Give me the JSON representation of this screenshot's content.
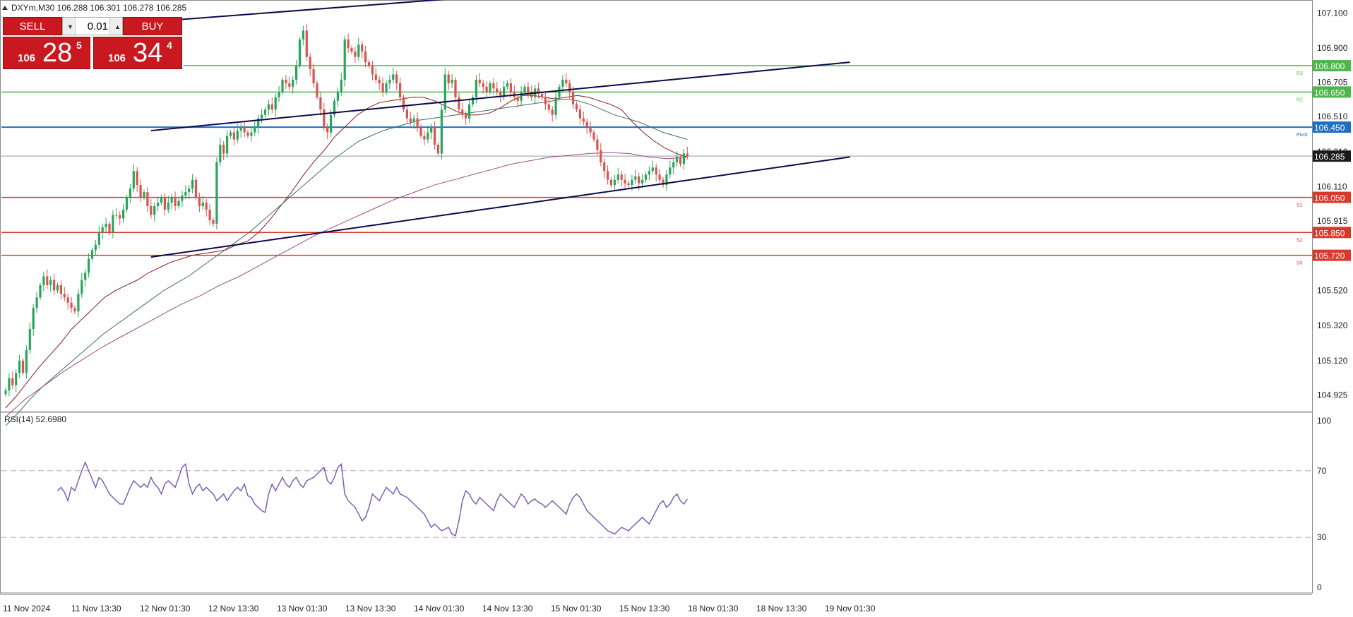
{
  "header": {
    "symbol_label": "DXYm,M30",
    "ohlc": "106.288 106.301 106.278 106.285"
  },
  "trade_panel": {
    "sell_label": "SELL",
    "buy_label": "BUY",
    "lot_value": "0.01",
    "sell_price": {
      "small": "106",
      "big": "28",
      "sup": "5"
    },
    "buy_price": {
      "small": "106",
      "big": "34",
      "sup": "4"
    }
  },
  "colors": {
    "bull_candle": "#26a65b",
    "bear_candle": "#d9534f",
    "pivot": "#1e6fc2",
    "resistance": "#4cb84c",
    "support": "#d83a2a",
    "trendline": "#0a0a4a",
    "ma_fast": "#8b1a1a",
    "ma_mid": "#3c6e60",
    "ma_slow": "#9b4a8c",
    "rsi": "#7b5fb8"
  },
  "chart_data": [
    {
      "type": "candlestick",
      "name": "DXYm,M30",
      "ylim": [
        104.85,
        107.15
      ],
      "price_axis_labels": [
        "107.100",
        "106.900",
        "106.705",
        "106.510",
        "106.310",
        "106.110",
        "105.915",
        "105.720",
        "105.520",
        "105.320",
        "105.120",
        "104.925"
      ],
      "x_tick_labels": [
        "11 Nov 2024",
        "11 Nov 13:30",
        "12 Nov 01:30",
        "12 Nov 13:30",
        "13 Nov 01:30",
        "13 Nov 13:30",
        "14 Nov 01:30",
        "14 Nov 13:30",
        "15 Nov 01:30",
        "15 Nov 13:30",
        "18 Nov 01:30",
        "18 Nov 13:30",
        "19 Nov 01:30"
      ],
      "current_price": {
        "value": 106.285,
        "label": "106.285"
      },
      "levels": [
        {
          "name": "R3",
          "value": 106.8,
          "label": "106.800",
          "kind": "resistance"
        },
        {
          "name": "R2",
          "value": 106.65,
          "label": "106.650",
          "kind": "resistance"
        },
        {
          "name": "Pivot",
          "value": 106.45,
          "label": "106.450",
          "kind": "pivot"
        },
        {
          "name": "S1",
          "value": 106.05,
          "label": "106.050",
          "kind": "support"
        },
        {
          "name": "S2",
          "value": 105.85,
          "label": "105.850",
          "kind": "support"
        },
        {
          "name": "S3",
          "value": 105.72,
          "label": "105.720",
          "kind": "support"
        }
      ],
      "trendlines": [
        {
          "from": {
            "bar": 42,
            "price": 107.05
          },
          "to": {
            "bar": 148,
            "price": 107.21
          }
        },
        {
          "from": {
            "bar": 42,
            "price": 106.43
          },
          "to": {
            "bar": 244,
            "price": 106.82
          }
        },
        {
          "from": {
            "bar": 42,
            "price": 105.71
          },
          "to": {
            "bar": 244,
            "price": 106.28
          }
        }
      ],
      "close": [
        104.95,
        105.02,
        104.98,
        105.05,
        105.12,
        105.05,
        105.18,
        105.3,
        105.42,
        105.48,
        105.55,
        105.6,
        105.55,
        105.58,
        105.52,
        105.55,
        105.5,
        105.48,
        105.45,
        105.42,
        105.4,
        105.5,
        105.58,
        105.62,
        105.7,
        105.75,
        105.78,
        105.85,
        105.88,
        105.9,
        105.85,
        105.95,
        105.95,
        105.93,
        105.98,
        106.05,
        106.1,
        106.2,
        106.12,
        106.05,
        106.08,
        106.0,
        105.95,
        106.0,
        106.02,
        106.05,
        105.98,
        106.02,
        106.05,
        106.0,
        106.03,
        106.06,
        106.08,
        106.1,
        106.15,
        106.05,
        106.0,
        106.02,
        105.98,
        105.92,
        105.9,
        106.25,
        106.35,
        106.3,
        106.4,
        106.42,
        106.38,
        106.43,
        106.45,
        106.42,
        106.4,
        106.42,
        106.45,
        106.5,
        106.52,
        106.55,
        106.58,
        106.55,
        106.62,
        106.65,
        106.72,
        106.7,
        106.68,
        106.72,
        106.8,
        106.95,
        107.0,
        106.85,
        106.78,
        106.7,
        106.62,
        106.55,
        106.45,
        106.42,
        106.52,
        106.6,
        106.65,
        106.72,
        106.95,
        106.9,
        106.88,
        106.85,
        106.92,
        106.88,
        106.82,
        106.8,
        106.75,
        106.72,
        106.7,
        106.65,
        106.7,
        106.72,
        106.75,
        106.7,
        106.62,
        106.55,
        106.5,
        106.48,
        106.5,
        106.45,
        106.4,
        106.38,
        106.42,
        106.45,
        106.35,
        106.3,
        106.55,
        106.75,
        106.7,
        106.72,
        106.62,
        106.55,
        106.52,
        106.5,
        106.58,
        106.62,
        106.72,
        106.7,
        106.68,
        106.65,
        106.7,
        106.67,
        106.65,
        106.63,
        106.68,
        106.7,
        106.65,
        106.62,
        106.6,
        106.65,
        106.68,
        106.65,
        106.62,
        106.67,
        106.64,
        106.62,
        106.58,
        106.55,
        106.52,
        106.62,
        106.68,
        106.72,
        106.7,
        106.65,
        106.58,
        106.55,
        106.5,
        106.48,
        106.45,
        106.42,
        106.38,
        106.32,
        106.25,
        106.2,
        106.15,
        106.12,
        106.15,
        106.18,
        106.15,
        106.13,
        106.12,
        106.15,
        106.17,
        106.13,
        106.15,
        106.18,
        106.2,
        106.22,
        106.18,
        106.15,
        106.12,
        106.18,
        106.22,
        106.25,
        106.28,
        106.24,
        106.3,
        106.285
      ],
      "moving_averages": [
        {
          "values": [
            104.85,
            104.92,
            105.0,
            105.08,
            105.15,
            105.22,
            105.3,
            105.36,
            105.42,
            105.48,
            105.52,
            105.55,
            105.58,
            105.62,
            105.65,
            105.68,
            105.7,
            105.72,
            105.73,
            105.74,
            105.75,
            105.78,
            105.8,
            105.85,
            105.92,
            106.0,
            106.08,
            106.17,
            106.25,
            106.32,
            106.4,
            106.46,
            106.52,
            106.56,
            106.59,
            106.6,
            106.61,
            106.62,
            106.62,
            106.6,
            106.57,
            106.54,
            106.52,
            106.52,
            106.53,
            106.56,
            106.6,
            106.63,
            106.63,
            106.62,
            106.61,
            106.62,
            106.63,
            106.62,
            106.6,
            106.58,
            106.55,
            106.48,
            106.42,
            106.37,
            106.33,
            106.3,
            106.28
          ]
        },
        {
          "values": [
            104.75,
            104.82,
            104.9,
            104.97,
            105.03,
            105.09,
            105.15,
            105.21,
            105.27,
            105.32,
            105.37,
            105.42,
            105.47,
            105.52,
            105.56,
            105.6,
            105.65,
            105.7,
            105.75,
            105.8,
            105.85,
            105.91,
            105.97,
            106.03,
            106.09,
            106.15,
            106.21,
            106.27,
            106.32,
            106.37,
            106.4,
            106.43,
            106.45,
            106.47,
            106.49,
            106.5,
            106.51,
            106.52,
            106.53,
            106.54,
            106.55,
            106.56,
            106.57,
            106.58,
            106.59,
            106.6,
            106.61,
            106.6,
            106.58,
            106.55,
            106.52,
            106.5,
            106.48,
            106.45,
            106.42,
            106.4,
            106.38
          ]
        },
        {
          "values": [
            104.8,
            104.9,
            104.98,
            105.06,
            105.13,
            105.2,
            105.26,
            105.32,
            105.38,
            105.44,
            105.49,
            105.55,
            105.6,
            105.66,
            105.72,
            105.78,
            105.84,
            105.89,
            105.94,
            105.99,
            106.04,
            106.08,
            106.12,
            106.15,
            106.18,
            106.21,
            106.24,
            106.26,
            106.28,
            106.29,
            106.3,
            106.305,
            106.3,
            106.28,
            106.27,
            106.28
          ]
        }
      ]
    },
    {
      "type": "line",
      "title": "RSI(14) 52.6980",
      "ylim": [
        0,
        100
      ],
      "levels": [
        30,
        70
      ],
      "y_tick_labels": [
        "100",
        "70",
        "30",
        "0"
      ],
      "values": [
        58,
        60,
        57,
        52,
        60,
        58,
        64,
        70,
        75,
        70,
        65,
        60,
        66,
        64,
        60,
        56,
        54,
        52,
        50,
        50,
        55,
        60,
        64,
        62,
        60,
        62,
        60,
        66,
        62,
        60,
        56,
        62,
        64,
        62,
        60,
        66,
        72,
        74,
        62,
        56,
        60,
        62,
        58,
        60,
        58,
        56,
        52,
        54,
        56,
        52,
        55,
        58,
        60,
        58,
        62,
        55,
        54,
        50,
        48,
        46,
        45,
        56,
        62,
        58,
        62,
        66,
        62,
        60,
        64,
        66,
        62,
        60,
        64,
        65,
        66,
        68,
        70,
        72,
        64,
        62,
        66,
        72,
        74,
        56,
        52,
        50,
        48,
        44,
        40,
        42,
        48,
        56,
        54,
        52,
        56,
        60,
        58,
        56,
        60,
        56,
        55,
        54,
        52,
        50,
        48,
        46,
        44,
        40,
        36,
        38,
        36,
        34,
        35,
        36,
        32,
        31,
        40,
        52,
        58,
        56,
        52,
        50,
        54,
        52,
        50,
        48,
        46,
        52,
        56,
        54,
        52,
        50,
        48,
        52,
        56,
        54,
        50,
        52,
        53,
        51,
        50,
        48,
        50,
        52,
        50,
        48,
        46,
        44,
        50,
        54,
        56,
        54,
        50,
        46,
        44,
        42,
        40,
        38,
        36,
        34,
        33,
        32,
        34,
        36,
        35,
        34,
        36,
        38,
        40,
        42,
        40,
        38,
        42,
        46,
        50,
        52,
        48,
        50,
        54,
        56,
        52,
        50,
        53
      ]
    }
  ]
}
